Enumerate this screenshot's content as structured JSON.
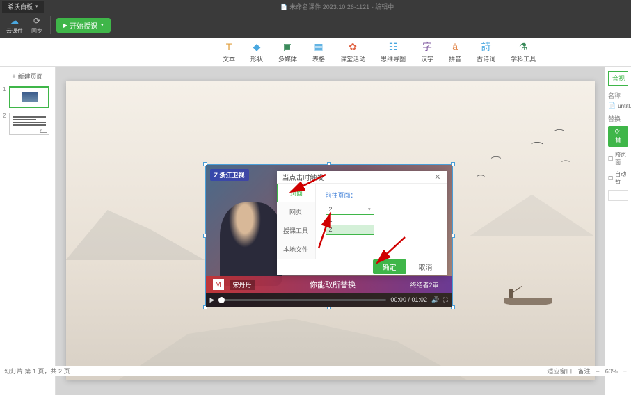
{
  "titlebar": {
    "menu": "希沃白板",
    "doc": "未命名课件 2023.10.26-1121 - 编辑中"
  },
  "top": {
    "cloud": "云课件",
    "sync": "同步",
    "start": "开始授课",
    "ribbon": {
      "text": "文本",
      "shape": "形状",
      "media": "多媒体",
      "table": "表格",
      "class": "课堂活动",
      "mind": "思维导图",
      "char": "汉字",
      "pinyin": "拼音",
      "ancient": "古诗词",
      "subject": "学科工具"
    }
  },
  "slides": {
    "newPage": "新建页面"
  },
  "video": {
    "logo": "Z 浙江卫视",
    "nameTag": "宋丹丹",
    "caption": "你能取所替换",
    "corner": "终结者2审…",
    "time": "00:00 / 01:02"
  },
  "modal": {
    "title": "当点击时触发",
    "tabs": {
      "page": "页面",
      "web": "网页",
      "tool": "授课工具",
      "local": "本地文件"
    },
    "label": "前往页面：",
    "selected": "2",
    "options": [
      "1",
      "2"
    ],
    "ok": "确定",
    "cancel": "取消"
  },
  "right": {
    "tab": "音视",
    "name": "名称",
    "file": "untitl...",
    "replace": "替换",
    "btn": "替",
    "opt1": "跨页面",
    "opt2": "自动暂"
  },
  "status": {
    "left": "幻灯片 第 1 页，共 2 页",
    "fit": "适应窗口",
    "notes": "备注",
    "zoom": "60%"
  }
}
